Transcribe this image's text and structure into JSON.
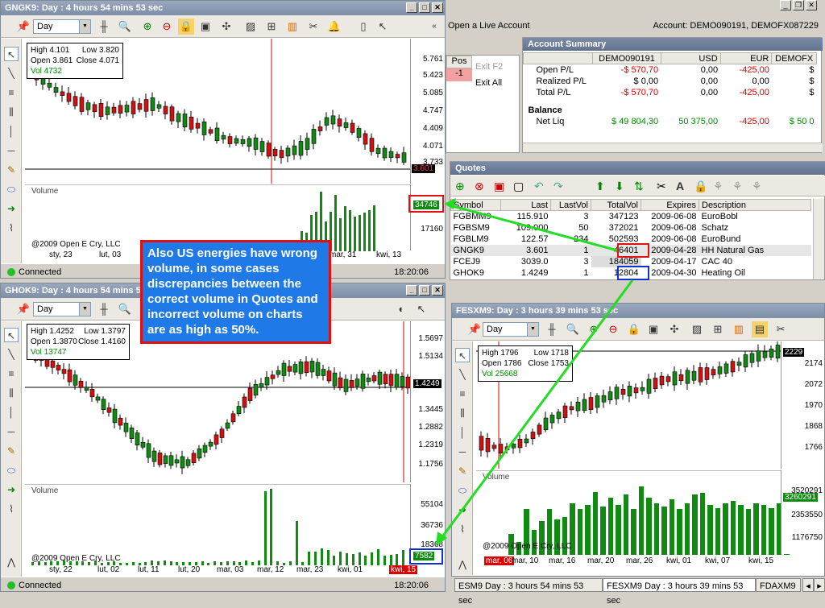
{
  "app": {
    "open_live": "Open a Live Account",
    "account_label": "Account: DEMO090191, DEMOFX087229"
  },
  "win1": {
    "title": "GNGK9: Day : 4 hours 54 mins 53 sec",
    "interval": "Day",
    "info": {
      "high": "High  4.101",
      "low": "Low  3.820",
      "open": "Open  3.861",
      "close": "Close  4.071",
      "vol": "Vol    4732"
    },
    "yticks": [
      "5.761",
      "5.423",
      "5.085",
      "4.747",
      "4.409",
      "4.071",
      "3.733"
    ],
    "last_price": "3.601",
    "volume_label": "Volume",
    "vol_tick": "17160",
    "vol_value": "34746",
    "copyright": "@2009 Open E Cry, LLC",
    "xticks": [
      "sty, 23",
      "lut, 03",
      "mar, 31",
      "kwi, 13"
    ],
    "status": "Connected",
    "time": "18:20:06"
  },
  "win2": {
    "title": "GHOK9: Day : 4 hours 54 mins 53 sec",
    "interval": "Day",
    "info": {
      "high": "High  1.4252",
      "low": "Low  1.3797",
      "open": "Open  1.3870",
      "close": "Close  1.4160",
      "vol": "Vol    13747"
    },
    "yticks": [
      "1.5697",
      "1.5134",
      "1.4249",
      "1.3445",
      "1.2882",
      "1.2319",
      "1.1756"
    ],
    "volume_label": "Volume",
    "vol_ticks": [
      "55104",
      "36736",
      "18368"
    ],
    "vol_value": "7582",
    "copyright": "@2009 Open E Cry, LLC",
    "xticks": [
      "sty, 22",
      "lut, 02",
      "lut, 11",
      "lut, 20",
      "mar, 03",
      "mar, 12",
      "mar, 23",
      "kwi, 01",
      "kwi, 15"
    ],
    "status": "Connected",
    "time": "18:20:06"
  },
  "win3": {
    "title": "FESXM9: Day : 3 hours 39 mins 53 sec",
    "interval": "Day",
    "info": {
      "high": "High   1796",
      "low": "Low  1718",
      "open": "Open   1786",
      "close": "Close  1753",
      "vol": "Vol  25668"
    },
    "yticks": [
      "2229",
      "2174",
      "2072",
      "1970",
      "1868",
      "1766"
    ],
    "volume_label": "Volume",
    "vol_ticks": [
      "3520291",
      "2353550",
      "1176750"
    ],
    "vol_value": "3260291",
    "copyright": "@2009 Open E Cry, LLC",
    "xticks": [
      "mar, 06",
      "mar, 10",
      "mar, 16",
      "mar, 20",
      "mar, 26",
      "kwi, 01",
      "kwi, 07",
      "kwi, 15"
    ]
  },
  "positions": {
    "header": "Pos",
    "value": "-1",
    "exit_f2": "Exit F2",
    "exit_all": "Exit All"
  },
  "account": {
    "title": "Account Summary",
    "columns": [
      "",
      "DEMO090191",
      "USD",
      "EUR",
      "DEMOFX"
    ],
    "rows": [
      [
        "Open P/L",
        "-$ 570,70",
        "0,00",
        "-425,00",
        "$"
      ],
      [
        "Realized P/L",
        "$ 0,00",
        "0,00",
        "0,00",
        "$"
      ],
      [
        "Total P/L",
        "-$ 570,70",
        "0,00",
        "-425,00",
        "$"
      ]
    ],
    "balance": "Balance",
    "netliq": [
      "Net Liq",
      "$ 49 804,30",
      "50 375,00",
      "-425,00",
      "$ 50 0"
    ]
  },
  "quotes": {
    "title": "Quotes",
    "columns": [
      "Symbol",
      "Last",
      "LastVol",
      "TotalVol",
      "Expires",
      "Description"
    ],
    "rows": [
      [
        "FGBMM9",
        "115.910",
        "3",
        "347123",
        "2009-06-08",
        "EuroBobl"
      ],
      [
        "FGBSM9",
        "109.000",
        "50",
        "372021",
        "2009-06-08",
        "Schatz"
      ],
      [
        "FGBLM9",
        "122.57",
        "234",
        "502593",
        "2009-06-08",
        "EuroBund"
      ],
      [
        "GNGK9",
        "3.601",
        "1",
        "46401",
        "2009-04-28",
        "HH Natural Gas"
      ],
      [
        "FCEJ9",
        "3039.0",
        "3",
        "184059",
        "2009-04-17",
        "CAC 40"
      ],
      [
        "GHOK9",
        "1.4249",
        "1",
        "12804",
        "2009-04-30",
        "Heating Oil"
      ]
    ]
  },
  "callout": "Also US energies have wrong volume, in some cases discrepancies between the correct volume in Quotes and incorrect volume on charts are as high as 50%.",
  "tabs": [
    "ESM9 Day : 3 hours 54 mins 53 sec",
    "FESXM9 Day : 3 hours 39 mins 53 sec",
    "FDAXM9"
  ],
  "colors": {
    "up": "#118a11",
    "down": "#d11111",
    "highlight_red": "#d11",
    "highlight_blue": "#1030d0",
    "arrow": "#22dd22"
  }
}
